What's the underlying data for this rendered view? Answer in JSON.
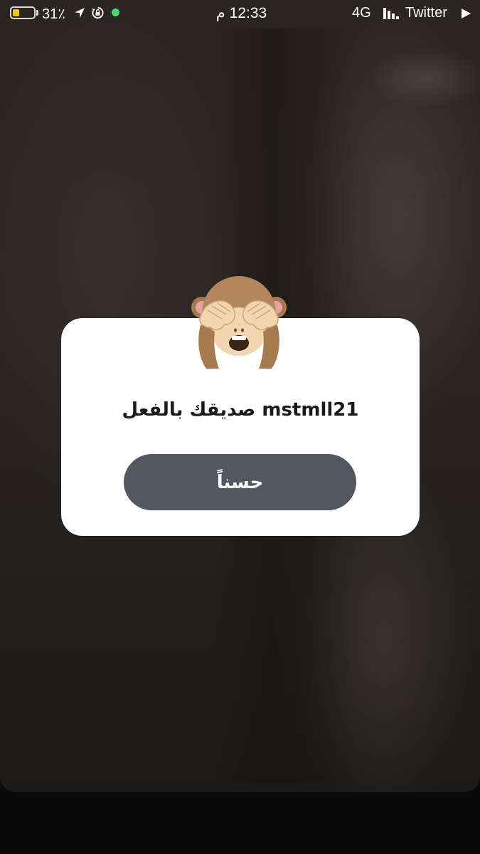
{
  "status_bar": {
    "battery_percent": "31٪",
    "battery_level": 0.31,
    "time": "12:33 م",
    "network": "4G",
    "back_to_app": "Twitter",
    "battery_color": "#f5c518",
    "active_dot_color": "#4cd964"
  },
  "icons": {
    "location": "location-arrow-icon",
    "rotation_lock": "rotation-lock-icon",
    "signal": "signal-bars-icon",
    "play": "play-icon",
    "emoji": "see-no-evil-monkey-icon"
  },
  "dialog": {
    "message": "mstmll21 صديقك بالفعل",
    "ok_button_label": "حسناً",
    "button_color": "#535860"
  }
}
